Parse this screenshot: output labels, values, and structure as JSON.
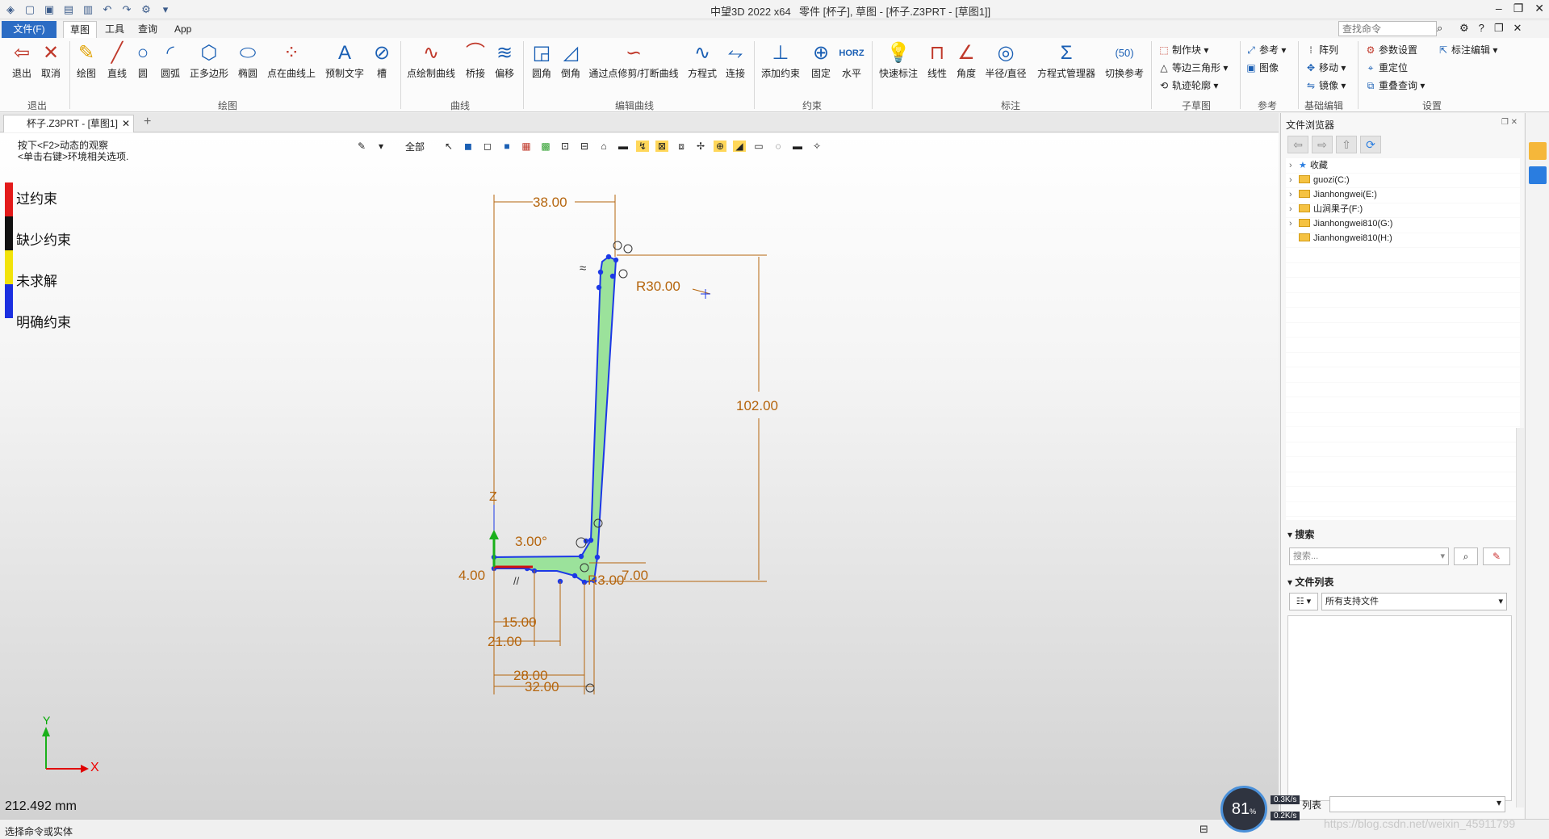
{
  "titlebar": {
    "app_title": "中望3D 2022 x64",
    "doc_title": "零件 [杯子], 草图 - [杯子.Z3PRT - [草图1]]",
    "minimize": "–",
    "maximize": "❐",
    "close": "✕"
  },
  "menu": {
    "file": "文件(F)",
    "sketch": "草图",
    "tools": "工具",
    "query": "查询",
    "app": "App",
    "search_placeholder": "查找命令"
  },
  "ribbon": {
    "groups": {
      "exit": "退出",
      "draw": "绘图",
      "curve": "曲线",
      "edit_curve": "编辑曲线",
      "constraint": "约束",
      "dimension": "标注",
      "subsketch": "子草图",
      "reference": "参考",
      "basic_edit": "基础编辑",
      "settings": "设置"
    },
    "buttons": {
      "exit": "退出",
      "cancel": "取消",
      "draw": "绘图",
      "line": "直线",
      "circle": "圆",
      "arc": "圆弧",
      "polygon": "正多边形",
      "ellipse": "椭圆",
      "point_on_curve": "点在曲线上",
      "pre_text": "预制文字",
      "slot": "槽",
      "point_curve": "点绘制曲线",
      "bridge": "桥接",
      "offset": "偏移",
      "fillet": "圆角",
      "chamfer": "倒角",
      "trim": "通过点修剪/打断曲线",
      "equation": "方程式",
      "connect": "连接",
      "add_constraint": "添加约束",
      "fix": "固定",
      "horizontal": "水平",
      "quick_dim": "快速标注",
      "linear": "线性",
      "angle": "角度",
      "radius": "半径/直径",
      "eq_manager": "方程式管理器",
      "toggle_ref": "切换参考"
    },
    "small": {
      "make_block": "制作块",
      "equilateral": "等边三角形",
      "trace": "轨迹轮廓",
      "ref": "参考",
      "image": "图像",
      "array": "阵列",
      "move": "移动",
      "mirror": "镜像",
      "param_settings": "参数设置",
      "relocate": "重定位",
      "overlap_query": "重叠查询",
      "dim_edit": "标注编辑"
    }
  },
  "doctab": {
    "label": "杯子.Z3PRT - [草图1]",
    "close": "✕",
    "new": "+"
  },
  "viewport": {
    "hint_line1": "按下<F2>动态的观察",
    "hint_line2": "<单击右键>环境相关选项.",
    "filter_all": "全部",
    "legend": [
      {
        "label": "过约束",
        "color": "#e31b1b"
      },
      {
        "label": "缺少约束",
        "color": "#111111"
      },
      {
        "label": "未求解",
        "color": "#f2e30a"
      },
      {
        "label": "明确约束",
        "color": "#1b2fe0"
      }
    ],
    "measure": "212.492 mm",
    "axis_x": "X",
    "axis_y": "Y",
    "axis_z": "Z",
    "dims": {
      "d38": "38.00",
      "r30": "R30.00",
      "d102": "102.00",
      "a3": "3.00°",
      "d4": "4.00",
      "r3": "R3.00",
      "d7": "7.00",
      "d15": "15.00",
      "d21": "21.00",
      "d28": "28.00",
      "d32": "32.00"
    },
    "colors": {
      "dim": "#b5650d",
      "profile": "#1c39e6",
      "fill": "#9be29b"
    }
  },
  "file_browser": {
    "title": "文件浏览器",
    "tree": [
      {
        "label": "收藏",
        "type": "favorite"
      },
      {
        "label": "guozi(C:)",
        "type": "drive"
      },
      {
        "label": "Jianhongwei(E:)",
        "type": "drive"
      },
      {
        "label": "山涧果子(F:)",
        "type": "drive"
      },
      {
        "label": "Jianhongwei810(G:)",
        "type": "drive"
      },
      {
        "label": "Jianhongwei810(H:)",
        "type": "drive"
      }
    ],
    "search_header": "搜索",
    "search_placeholder": "搜索...",
    "file_list_header": "文件列表",
    "filter_value": "所有支持文件",
    "bottom_label": "列表"
  },
  "statusbar": {
    "text": "选择命令或实体",
    "net_percent": "81",
    "net_up": "0.3K/s",
    "net_down": "0.2K/s",
    "watermark": "https://blog.csdn.net/weixin_45911799"
  }
}
